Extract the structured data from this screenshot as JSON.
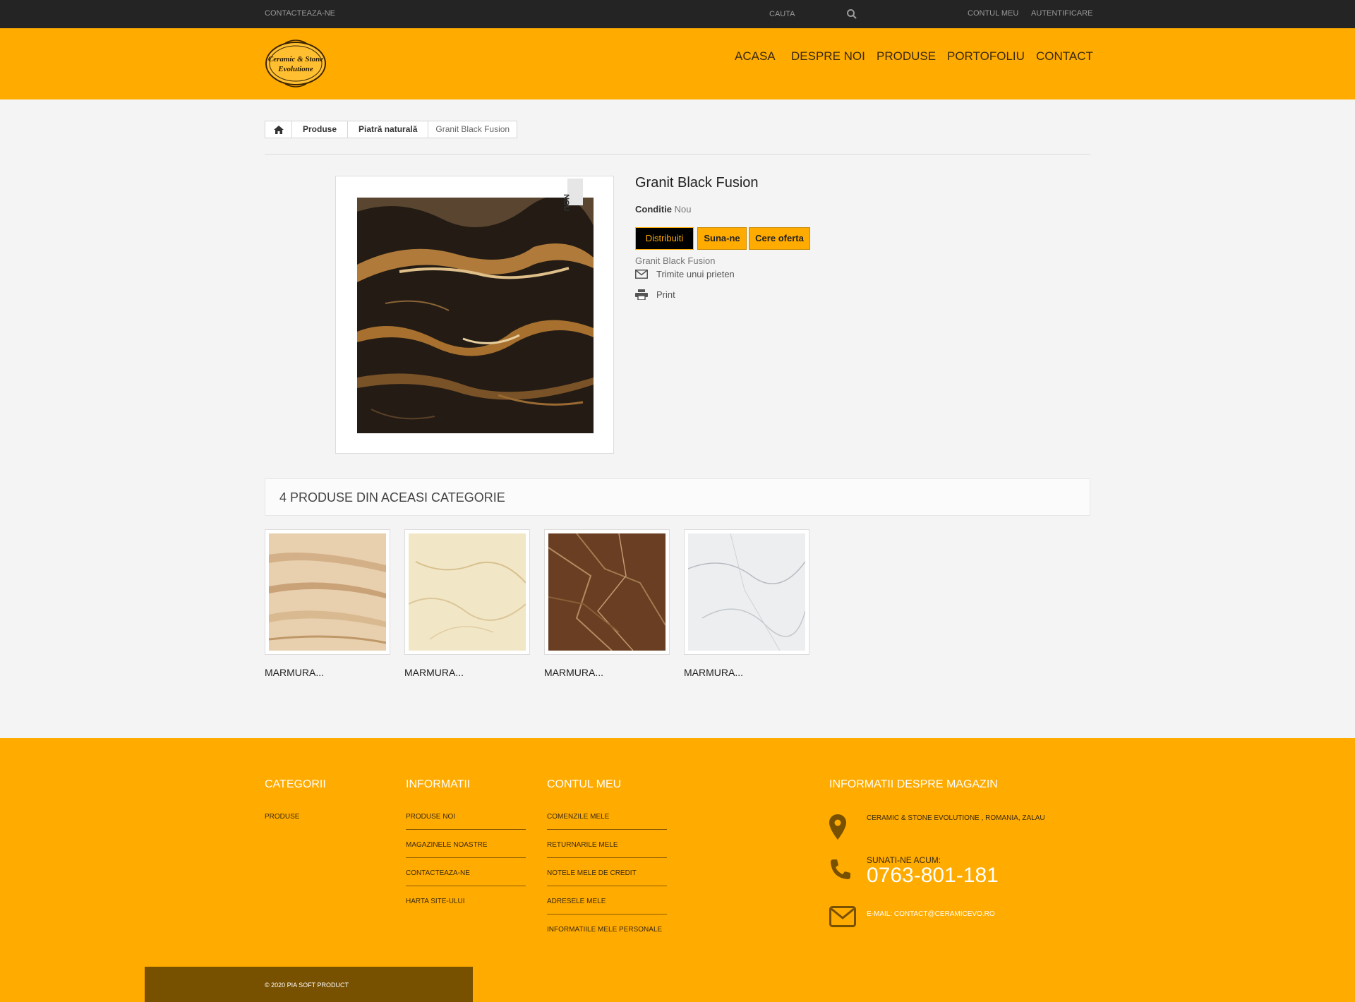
{
  "topbar": {
    "contact": "CONTACTEAZA-NE",
    "search_placeholder": "CAUTA",
    "account": "CONTUL MEU",
    "login": "AUTENTIFICARE"
  },
  "header": {
    "logo_line1": "Ceramic & Stone",
    "logo_line2": "Evolutione",
    "nav": [
      "ACASA",
      "DESPRE NOI",
      "PRODUSE",
      "PORTOFOLIU",
      "CONTACT"
    ]
  },
  "breadcrumb": {
    "items": [
      "Produse",
      "Piatră naturală",
      "Granit Black Fusion"
    ]
  },
  "product": {
    "new_tag": "NOU",
    "title": "Granit Black Fusion",
    "condition_label": "Conditie",
    "condition_value": "Nou",
    "buttons": [
      "Distribuiti",
      "Suna-ne",
      "Cere oferta"
    ],
    "description": "Granit Black Fusion",
    "send_friend": "Trimite unui prieten",
    "print": "Print"
  },
  "related": {
    "heading": "4 PRODUSE DIN ACEASI CATEGORIE",
    "items": [
      "MARMURA...",
      "MARMURA...",
      "MARMURA...",
      "MARMURA..."
    ]
  },
  "footer": {
    "categories": {
      "title": "CATEGORII",
      "links": [
        "PRODUSE"
      ]
    },
    "info": {
      "title": "INFORMATII",
      "links": [
        "PRODUSE NOI",
        "MAGAZINELE NOASTRE",
        "CONTACTEAZA-NE",
        "HARTA SITE-ULUI"
      ]
    },
    "account": {
      "title": "CONTUL MEU",
      "links": [
        "COMENZILE MELE",
        "RETURNARILE MELE",
        "NOTELE MELE DE CREDIT",
        "ADRESELE MELE",
        "INFORMATIILE MELE PERSONALE"
      ]
    },
    "store": {
      "title": "INFORMATII DESPRE MAGAZIN",
      "address": "CERAMIC & STONE EVOLUTIONE , ROMANIA, ZALAU",
      "call_label": "SUNATI-NE ACUM:",
      "phone": "0763-801-181",
      "email_label": "E-MAIL:",
      "email": "CONTACT@CERAMICEVO.RO"
    },
    "copyright": "© 2020 PIA SOFT PRODUCT"
  },
  "colors": {
    "accent": "#ffab00",
    "dark": "#242424",
    "footer_bottom": "#775000"
  }
}
